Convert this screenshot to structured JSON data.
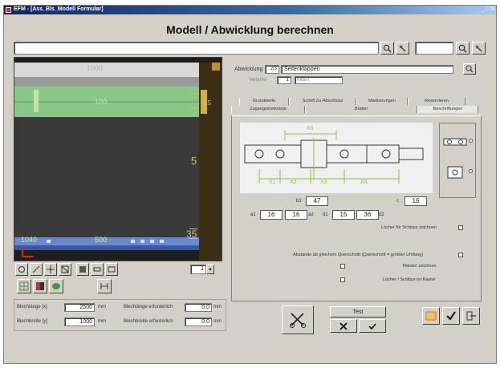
{
  "window": {
    "title": "EFM - [Ass_Bls_Modell Formular]",
    "controls": "_ □ X"
  },
  "heading": "Modell / Abwicklung berechnen",
  "viewport": {
    "labels": {
      "top": "1000",
      "mid": "100",
      "right_top": "1.5",
      "right_mid": "5",
      "bottom_left": "1040",
      "bottom_mid": "500",
      "bottom_right": "35"
    },
    "page_value": "1"
  },
  "abwicklung": {
    "label": "Abwicklung",
    "code": "2/3",
    "name": "Seitenklappen",
    "sub_label": "Variante",
    "sub_code": "1",
    "sub_name": "Intern"
  },
  "tabs_row1": [
    "Grundwerte",
    "Schrift Zu-Abschluss",
    "Markierungen",
    "Reservieren"
  ],
  "tabs_row2": [
    "Zugangsmerkmale",
    "Boden",
    "Beschriftungen"
  ],
  "diagram": {
    "labels": [
      "X1",
      "X2",
      "X3",
      "X4",
      "X5"
    ],
    "type_a": "Typ A",
    "type_b": "Typ B"
  },
  "params": {
    "b_label": "b1",
    "b_value": "47",
    "c_label": "c",
    "c_value": "16",
    "a_label": "a1",
    "a1": "16",
    "a2_label": "a2",
    "a2": "16",
    "d_label": "d1",
    "d1": "15",
    "d2_label": "d2",
    "d2": "36"
  },
  "options": {
    "opt1": "Löcher für Schloss zeichnen",
    "opt2": "Abstände ab gleichem Querschnitt (Querschnitt = größter Umfang)",
    "opt3": "Ränder zeichnen",
    "opt4": "Löcher / Schlitze im Raster"
  },
  "bottom_left": {
    "r1_l": "Blechlänge [x]",
    "r1_v": "2500",
    "r1_u": "mm",
    "r1_l2": "Blechlänge erforderlich",
    "r1_v2": "0.0",
    "r1_u2": "mm",
    "r2_l": "Blechbreite [y]",
    "r2_v": "1000",
    "r2_u": "mm",
    "r2_l2": "Blechbreite erforderlich",
    "r2_v2": "0.0",
    "r2_u2": "mm"
  },
  "buttons": {
    "test": "Test"
  },
  "colors": {
    "titlebar": "#0a246a",
    "panel": "#d4d0c8",
    "canvas_bg": "#2a2a2a",
    "sheet": "#3a3a3a"
  }
}
